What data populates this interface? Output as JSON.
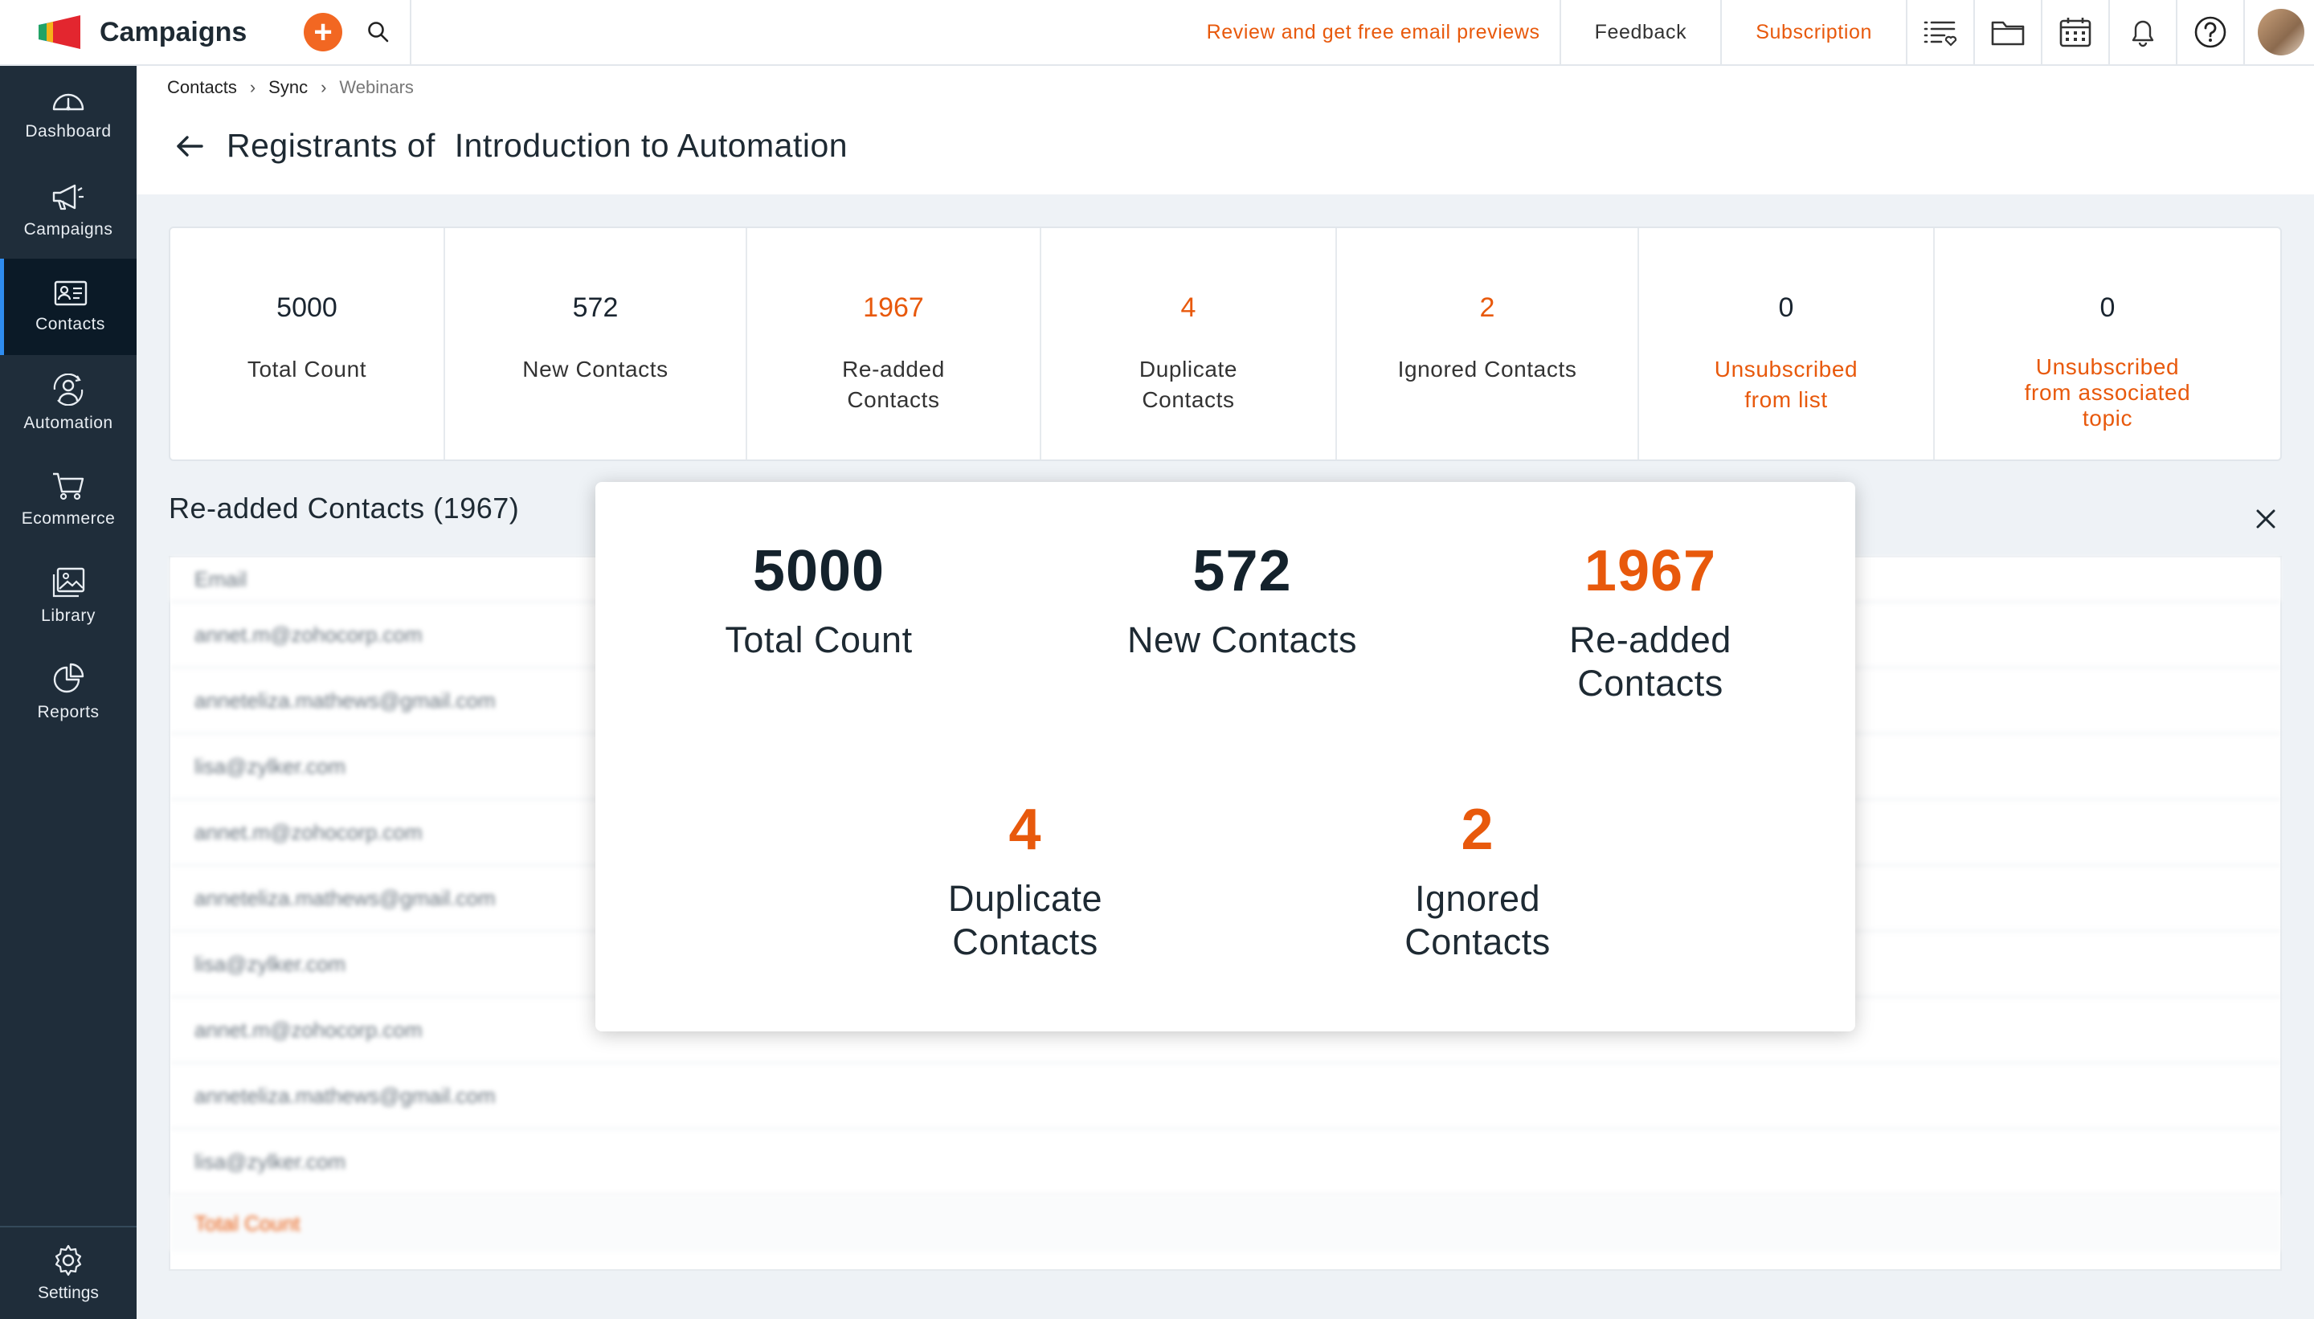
{
  "app": {
    "name": "Campaigns"
  },
  "topbar": {
    "review_link": "Review and get free email previews",
    "feedback": "Feedback",
    "subscription": "Subscription"
  },
  "sidebar": {
    "items": [
      {
        "label": "Dashboard",
        "icon": "dashboard-icon"
      },
      {
        "label": "Campaigns",
        "icon": "megaphone-icon"
      },
      {
        "label": "Contacts",
        "icon": "contact-card-icon"
      },
      {
        "label": "Automation",
        "icon": "automation-icon"
      },
      {
        "label": "Ecommerce",
        "icon": "cart-icon"
      },
      {
        "label": "Library",
        "icon": "image-library-icon"
      },
      {
        "label": "Reports",
        "icon": "pie-chart-icon"
      }
    ],
    "settings": "Settings"
  },
  "breadcrumb": {
    "contacts": "Contacts",
    "sync": "Sync",
    "webinars": "Webinars"
  },
  "page": {
    "title": "Registrants of  Introduction to Automation"
  },
  "stats": [
    {
      "value": "5000",
      "label": "Total Count",
      "value_color": "dark",
      "label_color": "dark"
    },
    {
      "value": "572",
      "label": "New Contacts",
      "value_color": "dark",
      "label_color": "dark"
    },
    {
      "value": "1967",
      "label": "Re-added\nContacts",
      "value_color": "orange",
      "label_color": "dark"
    },
    {
      "value": "4",
      "label": "Duplicate\nContacts",
      "value_color": "orange",
      "label_color": "dark"
    },
    {
      "value": "2",
      "label": "Ignored Contacts",
      "value_color": "orange",
      "label_color": "dark"
    },
    {
      "value": "0",
      "label": "Unsubscribed\nfrom list",
      "value_color": "dark",
      "label_color": "orange"
    },
    {
      "value": "0",
      "label": "Unsubscribed\nfrom associated\ntopic",
      "value_color": "dark",
      "label_color": "orange"
    }
  ],
  "section": {
    "title": "Re-added Contacts (1967)"
  },
  "table": {
    "header": "Email",
    "rows": [
      "annet.m@zohocorp.com",
      "anneteliza.mathews@gmail.com",
      "lisa@zylker.com",
      "annet.m@zohocorp.com",
      "anneteliza.mathews@gmail.com",
      "lisa@zylker.com",
      "annet.m@zohocorp.com",
      "anneteliza.mathews@gmail.com",
      "lisa@zylker.com"
    ],
    "footer": "Total Count"
  },
  "popup": {
    "total_value": "5000",
    "total_label": "Total Count",
    "new_value": "572",
    "new_label": "New Contacts",
    "readded_value": "1967",
    "readded_label": "Re-added\nContacts",
    "duplicate_value": "4",
    "duplicate_label": "Duplicate\nContacts",
    "ignored_value": "2",
    "ignored_label": "Ignored\nContacts"
  },
  "colors": {
    "accent": "#e8590c",
    "sidebar_bg": "#1f2d3a",
    "active_bar": "#2e8cf0"
  }
}
